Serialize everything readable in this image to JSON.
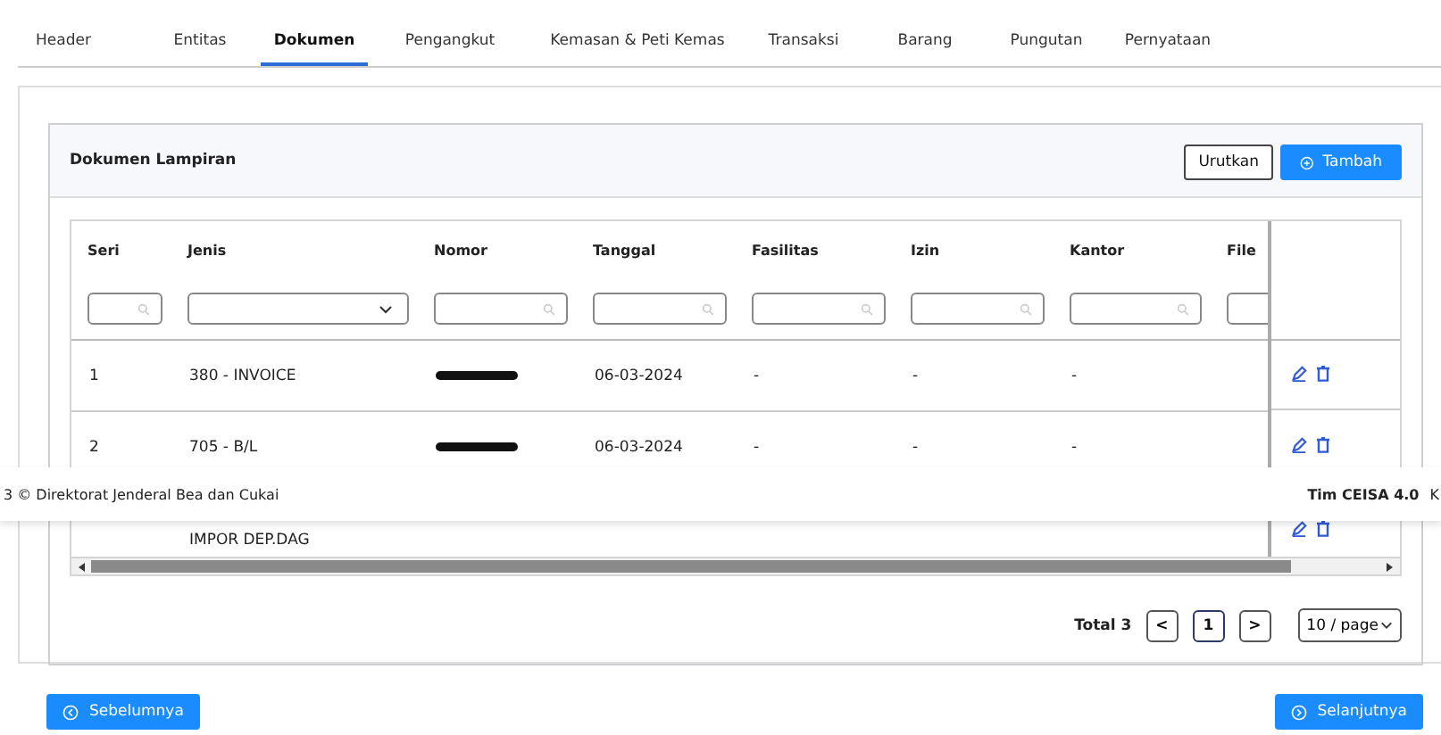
{
  "tabs": [
    {
      "label": "Header",
      "selected": false
    },
    {
      "label": "Entitas",
      "selected": false
    },
    {
      "label": "Dokumen",
      "selected": true
    },
    {
      "label": "Pengangkut",
      "selected": false
    },
    {
      "label": "Kemasan & Peti Kemas",
      "selected": false
    },
    {
      "label": "Transaksi",
      "selected": false
    },
    {
      "label": "Barang",
      "selected": false
    },
    {
      "label": "Pungutan",
      "selected": false
    },
    {
      "label": "Pernyataan",
      "selected": false
    }
  ],
  "card": {
    "title": "Dokumen Lampiran",
    "buttons": [
      {
        "label": "Urutkan",
        "kind": "outline"
      },
      {
        "label": "Tambah",
        "kind": "primary"
      }
    ]
  },
  "table": {
    "columns": [
      {
        "label": "Seri",
        "kind": "search"
      },
      {
        "label": "Jenis",
        "kind": "select"
      },
      {
        "label": "Nomor",
        "kind": "search"
      },
      {
        "label": "Tanggal",
        "kind": "search"
      },
      {
        "label": "Fasilitas",
        "kind": "search"
      },
      {
        "label": "Izin",
        "kind": "search"
      },
      {
        "label": "Kantor",
        "kind": "search"
      },
      {
        "label": "File",
        "kind": "search"
      }
    ],
    "rows": [
      {
        "seri": "1",
        "jenis": "380 - INVOICE",
        "nomor_redacted": true,
        "tanggal": "06-03-2024",
        "fasilitas": "-",
        "izin": "-",
        "kantor": "-"
      },
      {
        "seri": "2",
        "jenis": "705 - B/L",
        "nomor_redacted": true,
        "tanggal": "06-03-2024",
        "fasilitas": "-",
        "izin": "-",
        "kantor": "-"
      },
      {
        "jenis": "IMPOR DEP.DAG"
      }
    ]
  },
  "pagination": {
    "total": "Total 3",
    "prev": "<",
    "pages": [
      {
        "label": "1",
        "selected": true
      }
    ],
    "next": ">",
    "page_size": "10 / page"
  },
  "footer": {
    "left": "3 © Direktorat Jenderal Bea dan Cukai",
    "right": "Tim CEISA 4.0",
    "right_cut": "K"
  },
  "nav": {
    "prev": "Sebelumnya",
    "next": "Selanjutnya"
  }
}
